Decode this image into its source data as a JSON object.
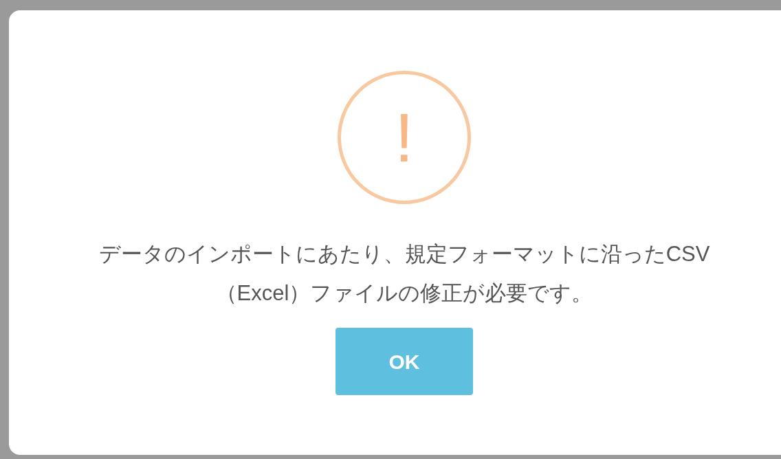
{
  "dialog": {
    "icon": {
      "kind": "warning",
      "symbol": "!"
    },
    "message": "データのインポートにあたり、規定フォーマットに沿ったCSV（Excel）ファイルの修正が必要です。",
    "buttons": [
      {
        "label": "OK",
        "kind": "confirm"
      }
    ]
  }
}
